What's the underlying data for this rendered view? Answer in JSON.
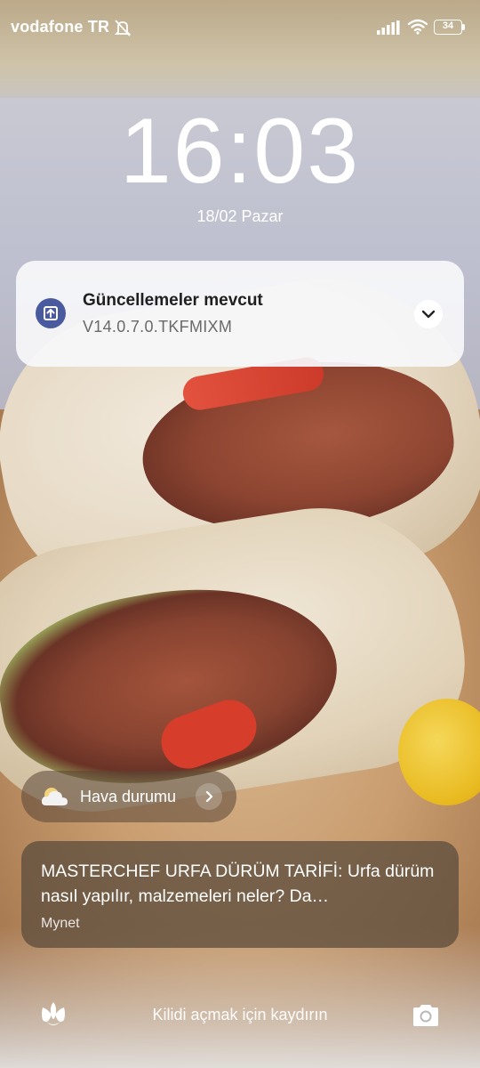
{
  "status_bar": {
    "carrier": "vodafone TR",
    "icons": [
      "mute-icon",
      "signal-icon",
      "wifi-icon",
      "battery-icon"
    ],
    "battery_level": "34"
  },
  "lock_screen": {
    "time": "16:03",
    "date": "18/02 Pazar"
  },
  "update_notification": {
    "title": "Güncellemeler mevcut",
    "subtitle": "V14.0.7.0.TKFMIXM",
    "icon": "upload-arrow-icon",
    "icon_color": "#4a5a9e"
  },
  "weather_widget": {
    "label": "Hava durumu",
    "icon": "cloud-icon"
  },
  "news_card": {
    "headline": "MASTERCHEF URFA DÜRÜM TARİFİ: Urfa dürüm nasıl yapılır, malzemeleri neler? Da…",
    "source": "Mynet"
  },
  "bottom_bar": {
    "unlock_hint": "Kilidi açmak için kaydırın",
    "left_icon": "tulip-icon",
    "right_icon": "camera-icon"
  }
}
